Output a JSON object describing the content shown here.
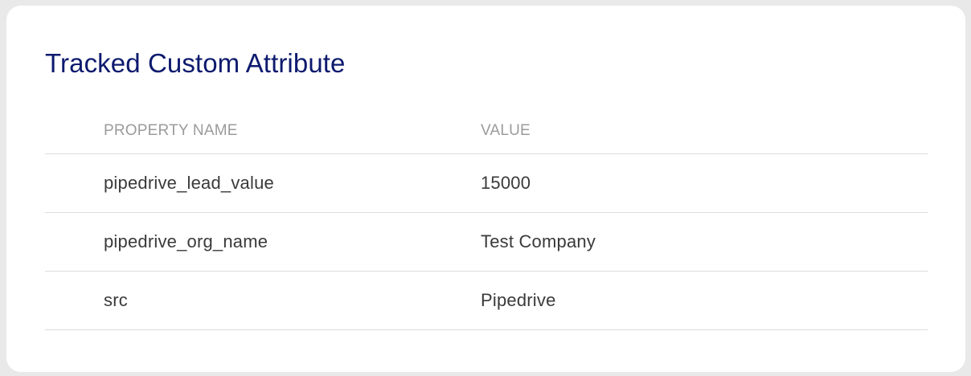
{
  "card": {
    "title": "Tracked Custom Attribute"
  },
  "table": {
    "columns": {
      "name": "PROPERTY NAME",
      "value": "VALUE"
    },
    "rows": [
      {
        "name": "pipedrive_lead_value",
        "value": "15000"
      },
      {
        "name": "pipedrive_org_name",
        "value": "Test Company"
      },
      {
        "name": "src",
        "value": "Pipedrive"
      }
    ]
  },
  "colors": {
    "title": "#0d1a6e",
    "header_text": "#9b9b9b",
    "body_text": "#3a3a3a",
    "divider": "#dcdcdc",
    "page_background": "#e9e9e9",
    "card_background": "#ffffff"
  }
}
